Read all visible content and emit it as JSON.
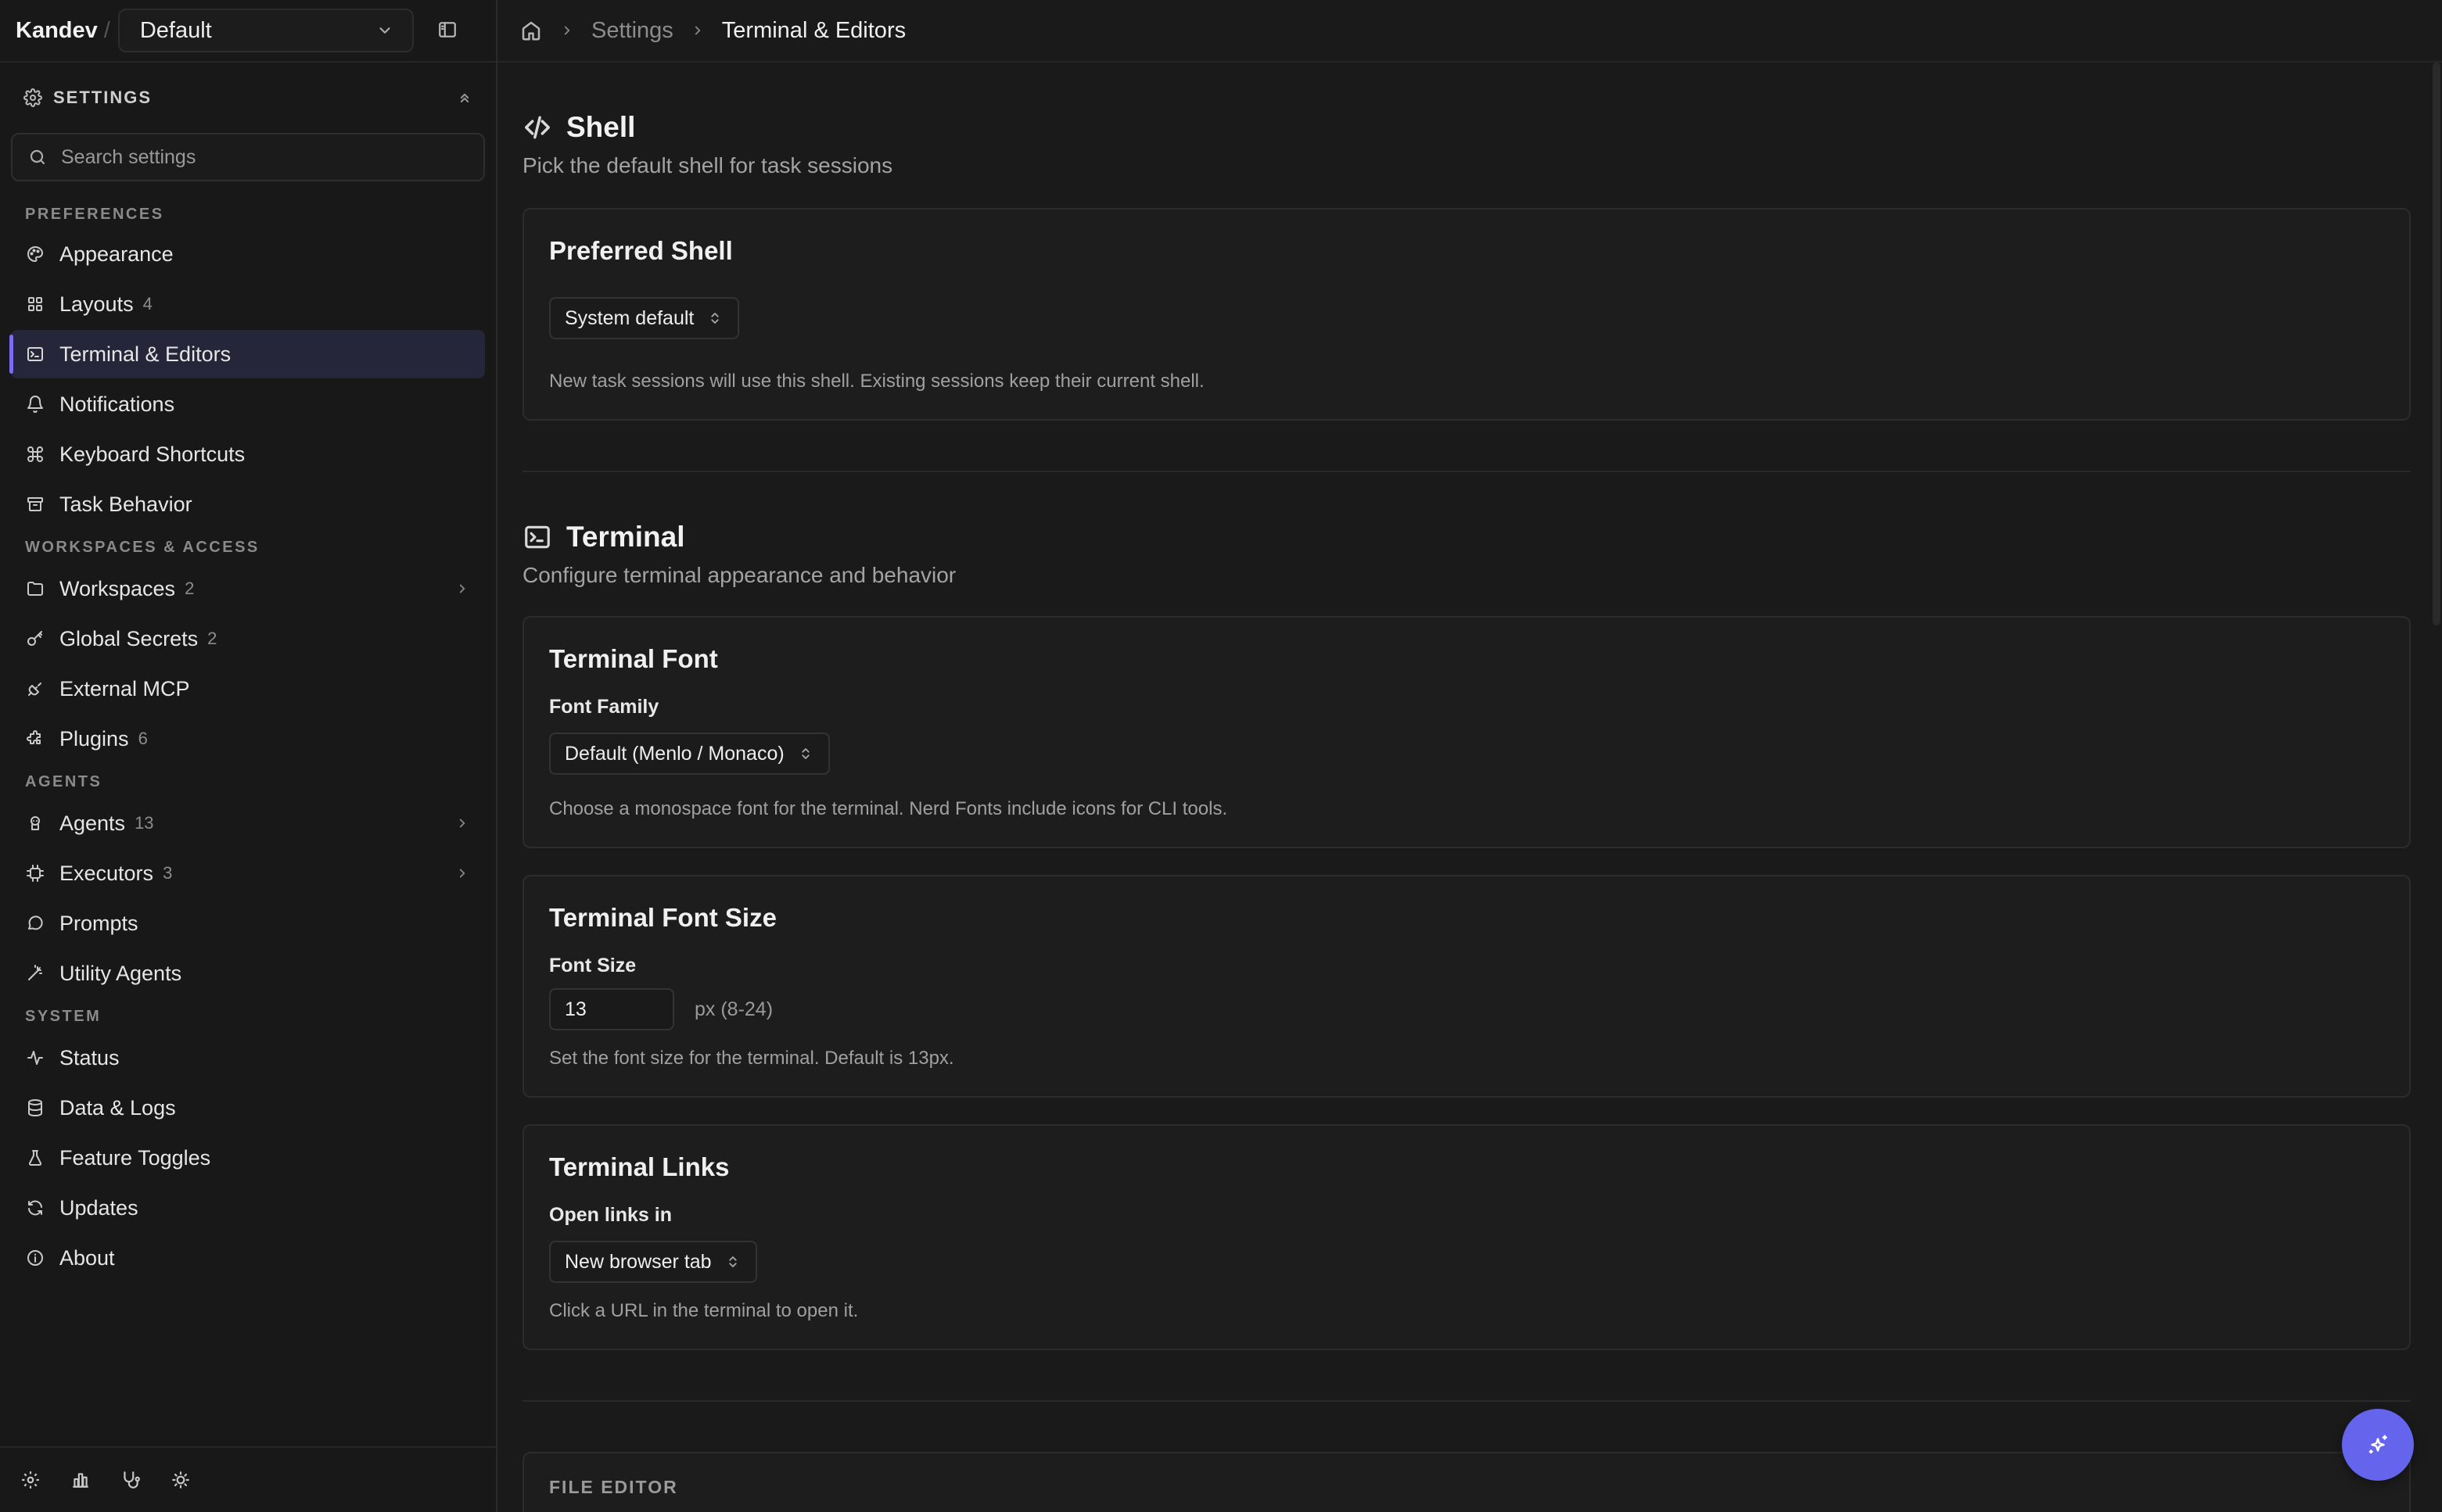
{
  "app": {
    "brand": "Kandev",
    "brand_separator": "/",
    "workspace": "Default"
  },
  "breadcrumb": {
    "settings": "Settings",
    "current": "Terminal & Editors"
  },
  "sidebar": {
    "settings_title": "SETTINGS",
    "search_placeholder": "Search settings",
    "groups": {
      "preferences": "PREFERENCES",
      "workspaces": "WORKSPACES & ACCESS",
      "agents": "AGENTS",
      "system": "SYSTEM"
    },
    "items": {
      "appearance": {
        "label": "Appearance",
        "icon": "palette-icon"
      },
      "layouts": {
        "label": "Layouts",
        "count": "4",
        "icon": "layout-grid-icon"
      },
      "terminal": {
        "label": "Terminal & Editors",
        "icon": "terminal-icon",
        "active": true
      },
      "notifications": {
        "label": "Notifications",
        "icon": "bell-icon"
      },
      "shortcuts": {
        "label": "Keyboard Shortcuts",
        "icon": "command-icon"
      },
      "task_behavior": {
        "label": "Task Behavior",
        "icon": "archive-icon"
      },
      "workspaces": {
        "label": "Workspaces",
        "count": "2",
        "icon": "folder-icon"
      },
      "global_secrets": {
        "label": "Global Secrets",
        "count": "2",
        "icon": "key-icon"
      },
      "external_mcp": {
        "label": "External MCP",
        "icon": "plug-icon"
      },
      "plugins": {
        "label": "Plugins",
        "count": "6",
        "icon": "puzzle-icon"
      },
      "agents": {
        "label": "Agents",
        "count": "13",
        "icon": "bot-icon"
      },
      "executors": {
        "label": "Executors",
        "count": "3",
        "icon": "cpu-icon"
      },
      "prompts": {
        "label": "Prompts",
        "icon": "message-icon"
      },
      "utility_agents": {
        "label": "Utility Agents",
        "icon": "wand-icon"
      },
      "status": {
        "label": "Status",
        "icon": "activity-icon"
      },
      "data_logs": {
        "label": "Data & Logs",
        "icon": "database-icon"
      },
      "feature_toggles": {
        "label": "Feature Toggles",
        "icon": "flask-icon"
      },
      "updates": {
        "label": "Updates",
        "icon": "refresh-icon"
      },
      "about": {
        "label": "About",
        "icon": "info-icon"
      }
    }
  },
  "shell": {
    "title": "Shell",
    "description": "Pick the default shell for task sessions",
    "preferred": {
      "title": "Preferred Shell",
      "value": "System default",
      "help": "New task sessions will use this shell. Existing sessions keep their current shell."
    }
  },
  "terminal": {
    "title": "Terminal",
    "description": "Configure terminal appearance and behavior",
    "font": {
      "title": "Terminal Font",
      "label": "Font Family",
      "value": "Default (Menlo / Monaco)",
      "help": "Choose a monospace font for the terminal. Nerd Fonts include icons for CLI tools."
    },
    "font_size": {
      "title": "Terminal Font Size",
      "label": "Font Size",
      "value": "13",
      "unit": "px (8-24)",
      "help": "Set the font size for the terminal. Default is 13px."
    },
    "links": {
      "title": "Terminal Links",
      "label": "Open links in",
      "value": "New browser tab",
      "help": "Click a URL in the terminal to open it."
    }
  },
  "file_editor": {
    "title": "FILE EDITOR"
  },
  "colors": {
    "accent": "#7c6cf0",
    "fab": "#6464ec",
    "background": "#1a1a1a"
  }
}
